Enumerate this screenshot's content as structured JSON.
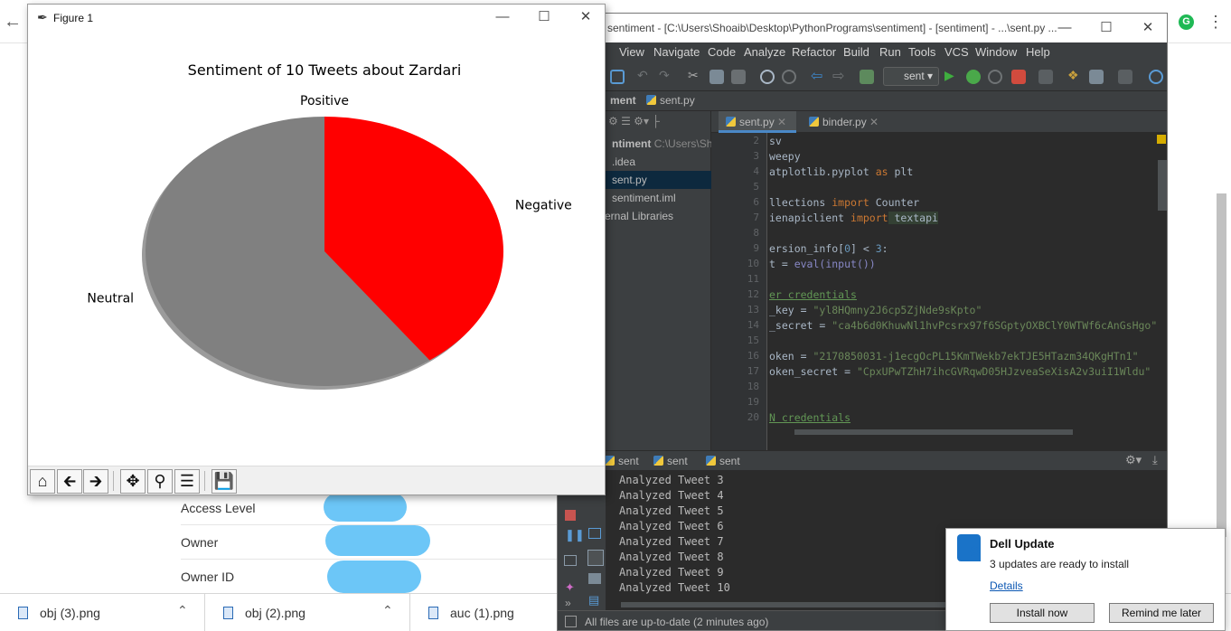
{
  "browser": {
    "back_icon": "arrow-left-icon",
    "account_icon_letter": "G",
    "menu_icon": "more-vert-icon",
    "properties": [
      {
        "label": "Access Level"
      },
      {
        "label": "Owner"
      },
      {
        "label": "Owner ID"
      }
    ],
    "downloads": [
      {
        "name": "obj (3).png"
      },
      {
        "name": "obj (2).png"
      },
      {
        "name": "auc (1).png"
      }
    ]
  },
  "pycharm": {
    "title": "sentiment - [C:\\Users\\Shoaib\\Desktop\\PythonPrograms\\sentiment] - [sentiment] - ...\\sent.py ...",
    "menu": [
      "View",
      "Navigate",
      "Code",
      "Analyze",
      "Refactor",
      "Build",
      "Run",
      "Tools",
      "VCS",
      "Window",
      "Help"
    ],
    "run_config": "sent",
    "breadcrumb": [
      "ment",
      "sent.py"
    ],
    "project_tree": [
      {
        "label": "ntiment",
        "path": "C:\\Users\\Sho"
      },
      {
        "label": ".idea"
      },
      {
        "label": "sent.py"
      },
      {
        "label": "sentiment.iml"
      },
      {
        "label": "ernal Libraries"
      }
    ],
    "tabs": [
      "sent.py",
      "binder.py"
    ],
    "editor": {
      "line_numbers": [
        "2",
        "3",
        "4",
        "5",
        "6",
        "7",
        "8",
        "9",
        "10",
        "11",
        "12",
        "13",
        "14",
        "15",
        "16",
        "17",
        "18",
        "19",
        "20"
      ],
      "lines": {
        "l2": "sv",
        "l3": "weepy",
        "l4a": "atplotlib.pyplot ",
        "l4kw": "as",
        "l4b": " plt",
        "l6a": "llections ",
        "l6kw": "import",
        "l6b": " Counter",
        "l7a": "ienapiclient ",
        "l7kw": "import",
        "l7b": " textapi",
        "l9a": "ersion_info[",
        "l9n": "0",
        "l9b": "] < ",
        "l9n2": "3",
        "l9c": ":",
        "l10a": "t = ",
        "l10b": "eval(input())",
        "l12": "er credentials",
        "l13a": "_key = ",
        "l13s": "\"yl8HQmny2J6cp5ZjNde9sKpto\"",
        "l14a": "_secret = ",
        "l14s": "\"ca4b6d0KhuwNl1hvPcsrx97f6SGptyOXBClY0WTWf6cAnGsHgo\"",
        "l16a": "oken = ",
        "l16s": "\"2170850031-j1ecgOcPL15KmTWekb7ekTJE5HTazm34QKgHTn1\"",
        "l17a": "oken_secret = ",
        "l17s": "\"CpxUPwTZhH7ihcGVRqwD05HJzveaSeXisA2v3uiI1Wldu\"",
        "l20": "N credentials"
      }
    },
    "run_tabs": [
      "sent",
      "sent",
      "sent"
    ],
    "console_lines": [
      "Analyzed Tweet 3",
      "Analyzed Tweet 4",
      "Analyzed Tweet 5",
      "Analyzed Tweet 6",
      "Analyzed Tweet 7",
      "Analyzed Tweet 8",
      "Analyzed Tweet 9",
      "Analyzed Tweet 10"
    ],
    "status": "All files are up-to-date (2 minutes ago)"
  },
  "figure": {
    "window_title": "Figure 1",
    "toolbar_icons": [
      "home-icon",
      "back-icon",
      "forward-icon",
      "pan-icon",
      "zoom-icon",
      "configure-subplots-icon",
      "save-icon"
    ]
  },
  "chart_data": {
    "type": "pie",
    "title": "Sentiment of 10 Tweets about Zardari",
    "labels": [
      "Positive",
      "Neutral",
      "Negative"
    ],
    "values": [
      0,
      6,
      4
    ],
    "colors": [
      "#808080",
      "#808080",
      "#ff0000"
    ],
    "shadow": true,
    "startangle": 90
  },
  "dell": {
    "title": "Dell Update",
    "message": "3 updates are ready to install",
    "details_link": "Details",
    "install_label": "Install now",
    "remind_label": "Remind me later"
  }
}
